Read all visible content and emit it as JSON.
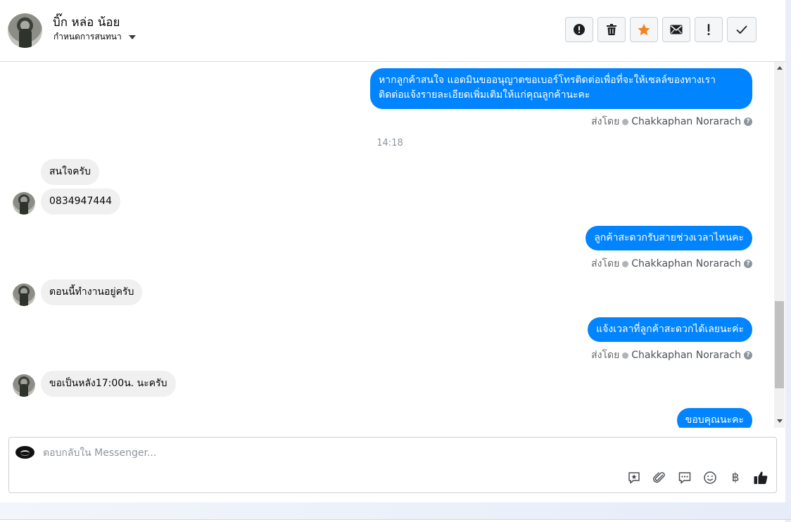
{
  "header": {
    "contact_name": "บิ๊ก หล่อ น้อย",
    "label_text": "กำหนดการสนทนา",
    "actions": [
      {
        "name": "report-spam-button",
        "icon": "exclamation-circle-icon"
      },
      {
        "name": "delete-button",
        "icon": "trash-icon"
      },
      {
        "name": "star-button",
        "icon": "star-icon",
        "color": "#f5821f"
      },
      {
        "name": "mark-unread-button",
        "icon": "envelope-icon"
      },
      {
        "name": "follow-up-button",
        "icon": "exclamation-icon"
      },
      {
        "name": "mark-done-button",
        "icon": "check-icon"
      }
    ]
  },
  "messages": {
    "out1_line1": "หากลูกค้าสนใจ แอดมินขออนุญาตขอเบอร์โทรติดต่อเพื่อที่จะให้เซลล์ของทางเรา",
    "out1_line2": "ติดต่อแจ้งรายละเอียดเพิ่มเติมให้แก่คุณลูกค้านะคะ",
    "timestamp": "14:18",
    "in1": "สนใจครับ",
    "in2": "0834947444",
    "out2": "ลูกค้าสะดวกรับสายช่วงเวลาไหนคะ",
    "in3": "ตอนนี้ทำงานอยู่ครับ",
    "out3": "แจ้งเวลาที่ลูกค้าสะดวกได้เลยนะค่ะ",
    "in4": "ขอเป็นหลัง17:00น. นะครับ",
    "out4": "ขอบคุณนะคะ",
    "sent_by_prefix": "ส่งโดย",
    "sender_name": "Chakkaphan Norarach",
    "help_glyph": "?"
  },
  "composer": {
    "placeholder": "ตอบกลับใน Messenger...",
    "value": "",
    "tools": [
      "saved-reply-icon",
      "attachment-icon",
      "chat-bubble-icon",
      "emoji-icon",
      "baht-icon",
      "thumbs-up-icon"
    ],
    "baht_glyph": "฿"
  },
  "colors": {
    "outgoing_bubble": "#0084ff",
    "incoming_bubble": "#f0f0f0",
    "star": "#f5821f"
  }
}
